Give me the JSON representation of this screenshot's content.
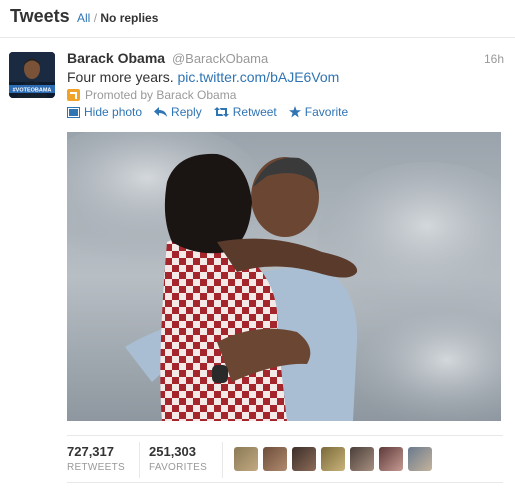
{
  "header": {
    "title": "Tweets",
    "filter_all": "All",
    "filter_separator": "/",
    "filter_no_replies": "No replies"
  },
  "tweet": {
    "fullname": "Barack Obama",
    "username": "@BarackObama",
    "time": "16h",
    "text": "Four more years.",
    "link": "pic.twitter.com/bAJE6Vom",
    "promoted": "Promoted by Barack Obama",
    "avatar_text": "#VOTEOBAMA",
    "actions": {
      "hide_photo": "Hide photo",
      "reply": "Reply",
      "retweet": "Retweet",
      "favorite": "Favorite"
    }
  },
  "stats": {
    "retweets_count": "727,317",
    "retweets_label": "RETWEETS",
    "favorites_count": "251,303",
    "favorites_label": "FAVORITES"
  },
  "colors": {
    "link": "#2f74b3",
    "promoted_badge": "#f0a32a",
    "muted": "#999999"
  }
}
